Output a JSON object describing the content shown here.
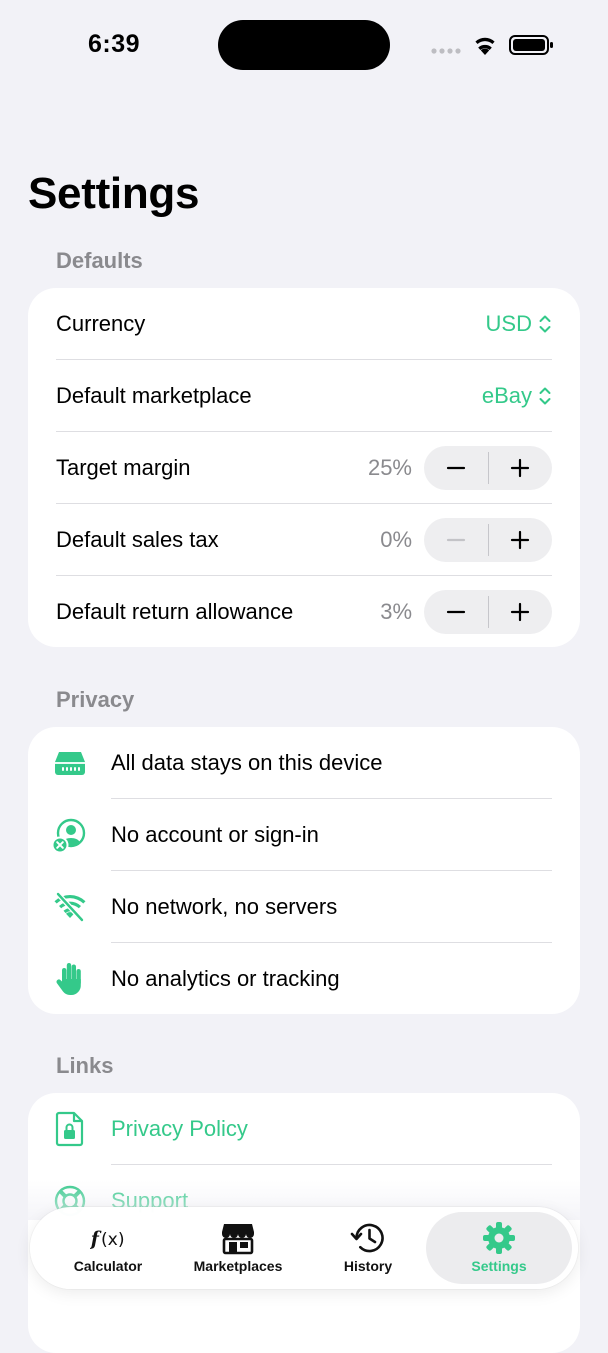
{
  "status_bar": {
    "time": "6:39"
  },
  "page": {
    "title": "Settings"
  },
  "defaults": {
    "header": "Defaults",
    "currency": {
      "label": "Currency",
      "value": "USD"
    },
    "marketplace": {
      "label": "Default marketplace",
      "value": "eBay"
    },
    "target_margin": {
      "label": "Target margin",
      "value": "25%"
    },
    "sales_tax": {
      "label": "Default sales tax",
      "value": "0%"
    },
    "return_allowance": {
      "label": "Default return allowance",
      "value": "3%"
    }
  },
  "privacy": {
    "header": "Privacy",
    "items": [
      {
        "label": "All data stays on this device",
        "icon": "device-storage-icon"
      },
      {
        "label": "No account or sign-in",
        "icon": "no-account-icon"
      },
      {
        "label": "No network, no servers",
        "icon": "no-wifi-icon"
      },
      {
        "label": "No analytics or tracking",
        "icon": "hand-raised-icon"
      }
    ]
  },
  "links": {
    "header": "Links",
    "items": [
      {
        "label": "Privacy Policy",
        "icon": "document-lock-icon"
      },
      {
        "label": "Support",
        "icon": "lifebuoy-icon"
      }
    ]
  },
  "tabs": [
    {
      "label": "Calculator",
      "icon": "function-icon",
      "active": false
    },
    {
      "label": "Marketplaces",
      "icon": "storefront-icon",
      "active": false
    },
    {
      "label": "History",
      "icon": "history-clock-icon",
      "active": false
    },
    {
      "label": "Settings",
      "icon": "gear-icon",
      "active": true
    }
  ],
  "colors": {
    "accent": "#34c98a",
    "background": "#f2f2f7",
    "card": "#ffffff",
    "secondary_text": "#8a8a8e"
  }
}
